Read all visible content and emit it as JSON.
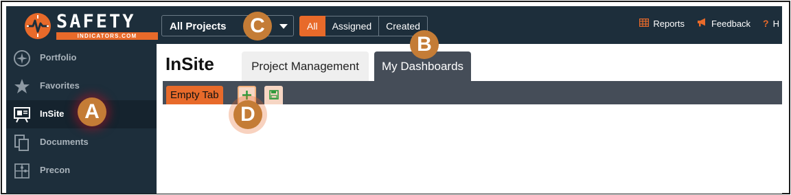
{
  "header": {
    "logo": {
      "word": "SAFETY",
      "subtitle": "INDICATORS.COM"
    },
    "project_select": {
      "value": "All Projects"
    },
    "filters": [
      "All",
      "Assigned",
      "Created"
    ],
    "active_filter": "All",
    "links": [
      {
        "label": "Reports",
        "icon": "table-icon"
      },
      {
        "label": "Feedback",
        "icon": "megaphone-icon"
      },
      {
        "label": "H",
        "icon": "help-icon"
      }
    ]
  },
  "sidebar": {
    "items": [
      {
        "label": "Portfolio",
        "icon": "compass-icon"
      },
      {
        "label": "Favorites",
        "icon": "star-icon"
      },
      {
        "label": "InSite",
        "icon": "presentation-icon",
        "active": true
      },
      {
        "label": "Documents",
        "icon": "documents-icon"
      },
      {
        "label": "Precon",
        "icon": "puzzle-icon"
      }
    ]
  },
  "main": {
    "title": "InSite",
    "tabs": [
      {
        "label": "Project Management"
      },
      {
        "label": "My Dashboards",
        "active": true
      }
    ],
    "dashboard_tab": "Empty Tab"
  },
  "callouts": [
    "A",
    "B",
    "C",
    "D"
  ],
  "colors": {
    "brand_orange": "#e86a2a",
    "nav_dark": "#1d2e3b",
    "callout": "#c47c36"
  }
}
